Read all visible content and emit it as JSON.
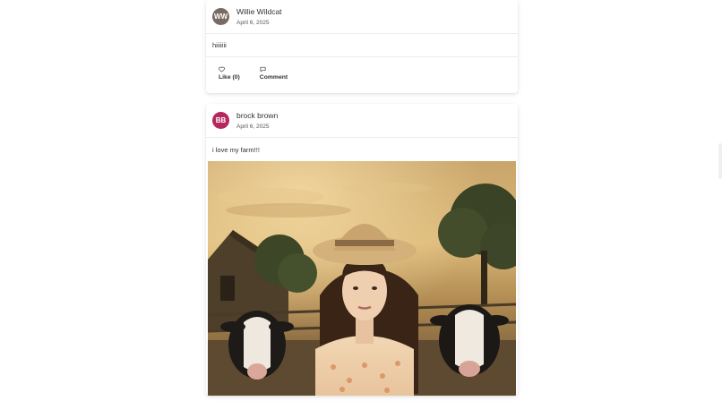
{
  "posts": [
    {
      "initials": "WW",
      "avatar_color": "#7a6a64",
      "author": "Willie Wildcat",
      "date": "April 6, 2025",
      "text": "hiiiiiii",
      "like_label": "Like (0)",
      "comment_label": "Comment"
    },
    {
      "initials": "BB",
      "avatar_color": "#b5275e",
      "author": "brock brown",
      "date": "April 6, 2025",
      "text": "i love my farm!!!"
    }
  ]
}
